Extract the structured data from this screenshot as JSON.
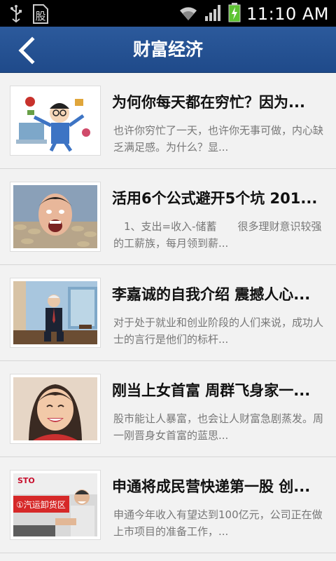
{
  "status_bar": {
    "time": "11:10 AM",
    "icons": [
      "usb-icon",
      "stock-notification-icon",
      "wifi-icon",
      "signal-icon",
      "battery-charging-icon"
    ],
    "notification_glyph": "股"
  },
  "app_bar": {
    "title": "财富经济",
    "back_icon": "chevron-left-icon"
  },
  "articles": [
    {
      "title": "为何你每天都在穷忙？因为...",
      "summary": "也许你穷忙了一天，也许你无事可做，内心缺乏满足感。为什么？显..."
    },
    {
      "title": "活用6个公式避开5个坑 201...",
      "summary": "　1、支出=收入-储蓄　　很多理财意识较强的工薪族，每月领到薪..."
    },
    {
      "title": "李嘉诚的自我介绍 震撼人心...",
      "summary": "对于处于就业和创业阶段的人们来说，成功人士的言行是他们的标杆..."
    },
    {
      "title": "刚当上女首富 周群飞身家一...",
      "summary": "股市能让人暴富，也会让人财富急剧蒸发。周一刚晋身女首富的蓝思..."
    },
    {
      "title": "申通将成民营快递第一股 创...",
      "summary": "申通今年收入有望达到100亿元，公司正在做上市项目的准备工作，..."
    }
  ],
  "thumb_texts": {
    "sto_logo": "STO",
    "sto_banner": "①汽运卸货区"
  }
}
